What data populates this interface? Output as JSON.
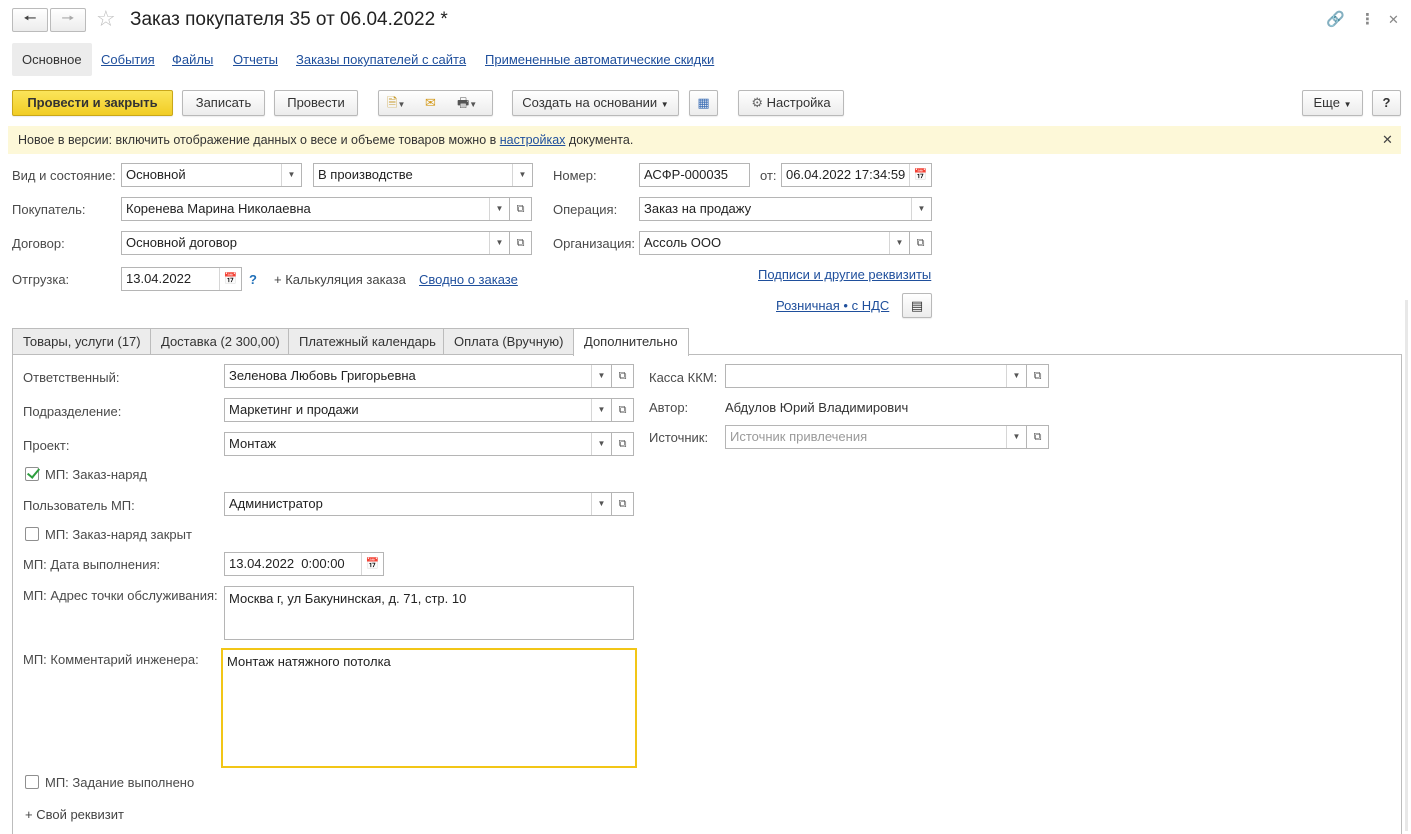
{
  "window": {
    "title": "Заказ покупателя 35 от 06.04.2022 *",
    "back_icon": "arrow-left-icon",
    "forward_icon": "arrow-right-icon",
    "star_icon": "star-outline-icon",
    "link_icon": "link-icon",
    "more_icon": "kebab-icon",
    "close_icon": "close-icon"
  },
  "sections": [
    "Основное",
    "События",
    "Файлы",
    "Отчеты",
    "Заказы покупателей с сайта",
    "Примененные автоматические скидки"
  ],
  "toolbar": {
    "post_close": "Провести и закрыть",
    "save": "Записать",
    "post": "Провести",
    "create_based": "Создать на основании",
    "settings": "Настройка",
    "more": "Еще",
    "help": "?"
  },
  "banner": {
    "text_before": "Новое в версии: включить отображение данных о весе и объеме товаров можно в ",
    "link": "настройках",
    "text_after": " документа."
  },
  "header": {
    "kind_label": "Вид и состояние:",
    "kind_value": "Основной",
    "state_value": "В производстве",
    "number_label": "Номер:",
    "number_value": "АСФР-000035",
    "date_label": "от:",
    "date_value": "06.04.2022 17:34:59",
    "customer_label": "Покупатель:",
    "customer_value": "Коренева Марина Николаевна",
    "operation_label": "Операция:",
    "operation_value": "Заказ на продажу",
    "contract_label": "Договор:",
    "contract_value": "Основной договор",
    "org_label": "Организация:",
    "org_value": "Ассоль ООО",
    "shipment_label": "Отгрузка:",
    "shipment_value": "13.04.2022",
    "shipment_help": "?",
    "calc_label": "+ Калькуляция заказа",
    "summary_link": "Сводно о заказе",
    "signatures_link": "Подписи и другие реквизиты",
    "price_link": "Розничная • с НДС"
  },
  "tabs": [
    "Товары, услуги (17)",
    "Доставка (2 300,00)",
    "Платежный календарь",
    "Оплата (Вручную)",
    "Дополнительно"
  ],
  "extra": {
    "responsible_label": "Ответственный:",
    "responsible_value": "Зеленова Любовь Григорьевна",
    "division_label": "Подразделение:",
    "division_value": "Маркетинг и продажи",
    "project_label": "Проект:",
    "project_value": "Монтаж",
    "mp_order_label": "МП: Заказ-наряд",
    "mp_user_label": "Пользователь МП:",
    "mp_user_value": "Администратор",
    "mp_closed_label": "МП: Заказ-наряд закрыт",
    "mp_date_label": "МП: Дата выполнения:",
    "mp_date_value": "13.04.2022  0:00:00",
    "mp_address_label": "МП: Адрес точки обслуживания:",
    "mp_address_value": "Москва г, ул Бакунинская, д. 71, стр. 10",
    "mp_comment_label": "МП: Комментарий инженера:",
    "mp_comment_value": "Монтаж натяжного потолка",
    "mp_done_label": "МП: Задание выполнено",
    "own_attr": "+ Свой реквизит",
    "kkm_label": "Касса ККМ:",
    "kkm_value": "",
    "author_label": "Автор:",
    "author_value": "Абдулов Юрий Владимирович",
    "source_label": "Источник:",
    "source_placeholder": "Источник привлечения"
  },
  "colors": {
    "primary_button": "#f1cd24",
    "banner_bg": "#fdf8d8",
    "link": "#1f4f9c",
    "focus_border": "#f2c617",
    "check": "#2e9e3e"
  }
}
